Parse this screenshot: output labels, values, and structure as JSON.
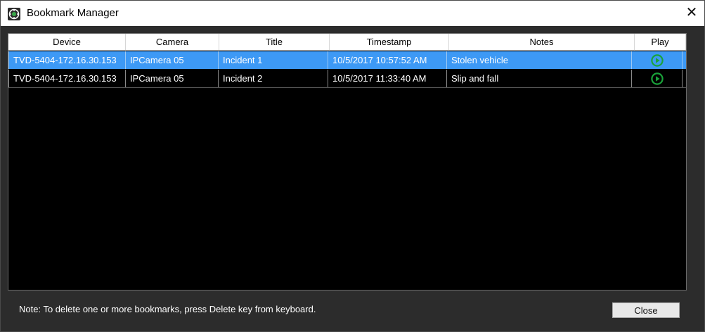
{
  "window": {
    "title": "Bookmark Manager",
    "close_glyph": "✕",
    "app_icon": "app-logo-icon"
  },
  "table": {
    "columns": [
      "Device",
      "Camera",
      "Title",
      "Timestamp",
      "Notes",
      "Play"
    ],
    "rows": [
      {
        "device": "TVD-5404-172.16.30.153",
        "camera": "IPCamera 05",
        "title": "Incident 1",
        "timestamp": "10/5/2017 10:57:52 AM",
        "notes": "Stolen vehicle",
        "play_icon": "play-circle-icon",
        "selected": true
      },
      {
        "device": "TVD-5404-172.16.30.153",
        "camera": "IPCamera 05",
        "title": "Incident 2",
        "timestamp": "10/5/2017 11:33:40 AM",
        "notes": "Slip and fall",
        "play_icon": "play-circle-icon",
        "selected": false
      }
    ]
  },
  "footer": {
    "note": "Note: To delete one or more bookmarks, press Delete key from keyboard.",
    "close_label": "Close"
  },
  "colors": {
    "selection": "#3d99f5",
    "grid_background": "#000000",
    "dialog_background": "#2c2c2c",
    "play_icon": "#1aa33a"
  }
}
